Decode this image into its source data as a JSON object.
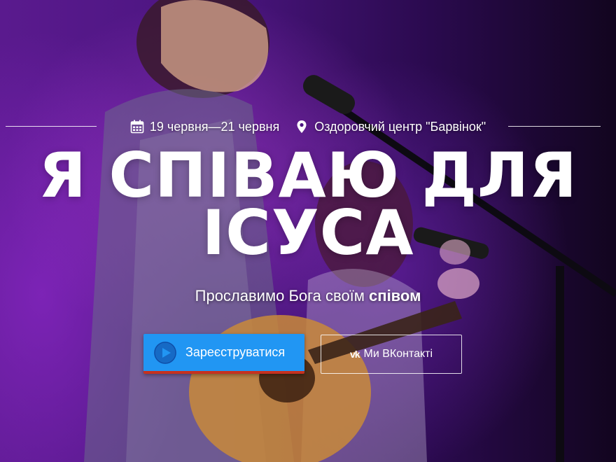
{
  "event": {
    "dates": "19 червня—21 червня",
    "location": "Оздоровчий центр \"Барвінок\"",
    "title": "Я СПІВАЮ ДЛЯ ІСУСА",
    "subtitle_prefix": "Прославимо Бога своїм ",
    "subtitle_bold": "співом"
  },
  "buttons": {
    "register_label": "Зареєструватися",
    "vk_icon": "vk",
    "vk_label": "Ми ВКонтакті"
  },
  "icons": {
    "calendar": "calendar-icon",
    "location": "map-pin-icon",
    "play": "play-circle-icon",
    "vk": "vk-logo-icon"
  },
  "colors": {
    "primary_button": "#2196f3",
    "button_accent": "#c6311f",
    "background": "#4b1580"
  }
}
